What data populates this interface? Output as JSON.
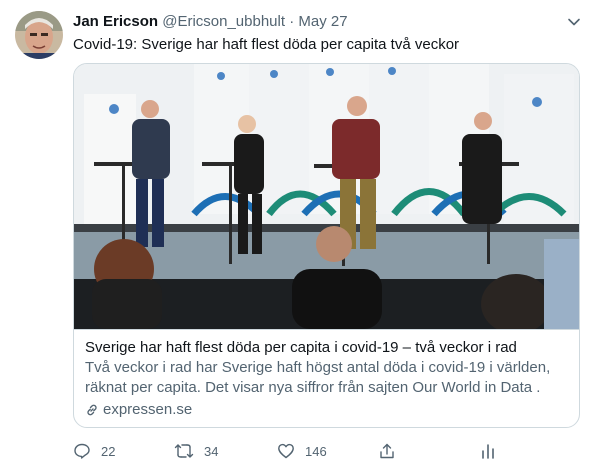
{
  "tweet": {
    "author_name": "Jan Ericson",
    "handle": "@Ericson_ubbhult",
    "separator": "·",
    "date": "May 27",
    "text": "Covid-19: Sverige har haft flest döda per capita två veckor"
  },
  "card": {
    "title": "Sverige har haft flest döda per capita i covid-19 – två veckor i rad",
    "description": "Två veckor i rad har Sverige haft högst antal döda i covid-19 i världen, räknat per capita. Det visar nya siffror från sajten Our World in Data .",
    "domain": "expressen.se",
    "image_semantic": "press-conference-photo"
  },
  "actions": {
    "reply_count": "22",
    "retweet_count": "34",
    "like_count": "146"
  },
  "icons": {
    "more": "chevron-down-icon",
    "reply": "reply-icon",
    "retweet": "retweet-icon",
    "like": "heart-icon",
    "share": "share-icon",
    "analytics": "analytics-icon",
    "link": "link-icon"
  },
  "colors": {
    "text_primary": "#0f1419",
    "text_secondary": "#536471",
    "border": "#cfd9de"
  }
}
